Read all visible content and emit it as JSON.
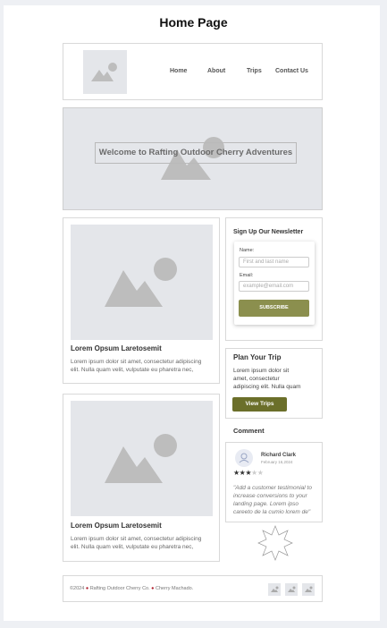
{
  "page_title": "Home Page",
  "nav": {
    "items": [
      "Home",
      "About",
      "Trips",
      "Contact Us"
    ]
  },
  "hero": {
    "title": "Welcome to Rafting Outdoor Cherry Adventures"
  },
  "cards": [
    {
      "title": "Lorem Opsum Laretosemit",
      "body": [
        "Lorem ipsum dolor sit amet, consectetur adipiscing",
        "elit. Nulla quam velit, vulputate eu pharetra nec,"
      ]
    },
    {
      "title": "Lorem Opsum Laretosemit",
      "body": [
        "Lorem ipsum dolor sit amet, consectetur adipiscing",
        "elit. Nulla quam velit, vulputate eu pharetra nec,"
      ]
    }
  ],
  "newsletter": {
    "title": "Sign Up Our Newsletter",
    "name_label": "Name:",
    "name_placeholder": "First and last name",
    "email_label": "Email:",
    "email_placeholder": "example@email.com",
    "button": "SUBSCRIBE"
  },
  "plan": {
    "title": "Plan Your Trip",
    "body": [
      "Lorem ipsum dolor sit",
      "amet, consectetur",
      "adipiscing elit. Nulla quam"
    ],
    "button": "View Trips"
  },
  "comment": {
    "title": "Comment",
    "name": "Richard Clark",
    "date": "February 16,2024",
    "rating": 3,
    "rating_max": 5,
    "text": [
      "\"Add a customer testimonial to",
      "increase conversions to your",
      "landing page. Lorem ipso",
      "careeto de la cumio lorem de\""
    ]
  },
  "footer": {
    "text_a": "©2024",
    "text_b": "Rafting Outdoor Cherry Co.",
    "text_c": "Cherry Machado."
  },
  "colors": {
    "olive": "#8b8f4e",
    "olive_dark": "#6b6f2a",
    "placeholder_gray": "#bdbdbd"
  }
}
